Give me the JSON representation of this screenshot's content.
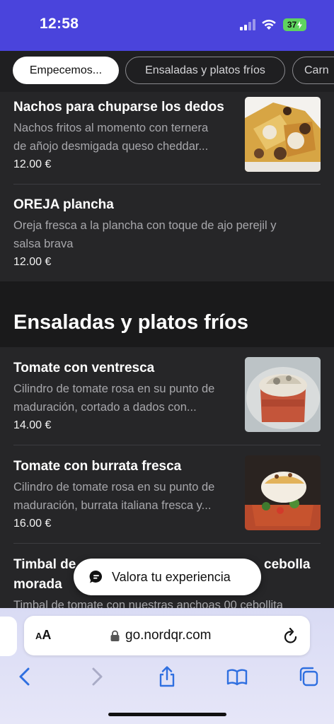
{
  "status_bar": {
    "time": "12:58",
    "battery": "37",
    "icons": [
      "cellular-signal-icon",
      "wifi-icon",
      "battery-charging-icon"
    ]
  },
  "tabs": [
    {
      "label": "Empecemos...",
      "active": true
    },
    {
      "label": "Ensaladas y platos fríos",
      "active": false
    },
    {
      "label": "Carn",
      "active": false
    }
  ],
  "menu": {
    "items_top": [
      {
        "title": "Nachos para chuparse los dedos",
        "desc_line1": "Nachos fritos al momento con ternera",
        "desc_line2": "de añojo desmigada queso cheddar...",
        "price": "12.00 €"
      },
      {
        "title": "OREJA plancha",
        "desc_line1": "Oreja fresca a la plancha con toque de ajo perejil y",
        "desc_line2": "salsa brava",
        "price": "12.00 €"
      }
    ],
    "section_title": "Ensaladas y platos fríos",
    "items_section": [
      {
        "title": "Tomate con ventresca",
        "desc_line1": "Cilindro de tomate rosa en su punto de",
        "desc_line2": "maduración, cortado a dados con...",
        "price": "14.00 €"
      },
      {
        "title": "Tomate con burrata fresca",
        "desc_line1": "Cilindro de tomate rosa en su punto de",
        "desc_line2": "maduración, burrata italiana fresca y...",
        "price": "16.00 €"
      },
      {
        "title_line1_left": "Timbal de",
        "title_line1_right": "cebolla",
        "title_line2": "morada",
        "desc_line1": "Timbal de tomate con nuestras anchoas 00 cebollita"
      }
    ]
  },
  "rate_button": {
    "label": "Valora tu experiencia",
    "icon": "chat-bubble-icon"
  },
  "browser": {
    "text_size_label_small": "A",
    "text_size_label_large": "A",
    "url": "go.nordqr.com",
    "toolbar": [
      "back-icon",
      "forward-icon",
      "share-icon",
      "bookmarks-icon",
      "tabs-icon"
    ]
  },
  "colors": {
    "status_bar": "#4a44dc",
    "background": "#262628",
    "section_band": "#1a1a1b",
    "battery": "#5fd35f",
    "ios_blue": "#2f6fe0"
  }
}
